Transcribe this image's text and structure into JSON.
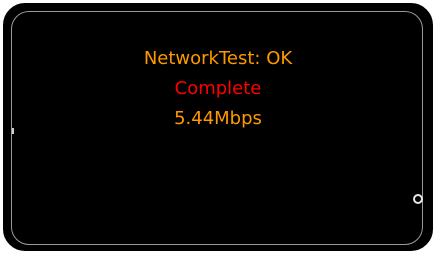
{
  "screen": {
    "title": "NetworkTest: OK",
    "status": "Complete",
    "speed": "5.44Mbps"
  },
  "colors": {
    "accent": "#ff9900",
    "status": "#ff0000",
    "background": "#000000"
  },
  "icons": {
    "home_button": "home-button-icon"
  }
}
